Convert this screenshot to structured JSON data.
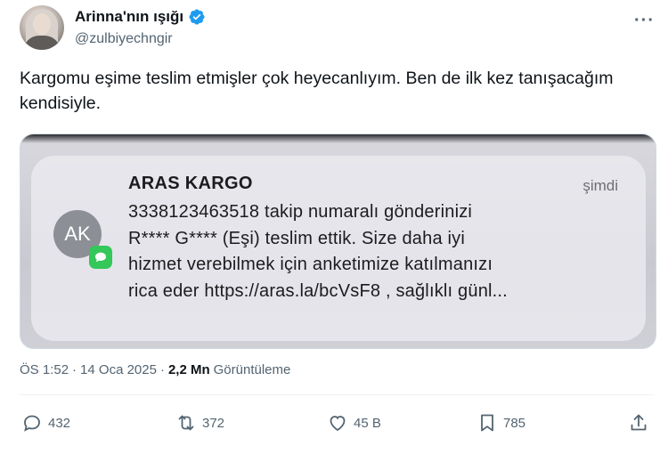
{
  "tweet": {
    "author": {
      "name": "Arinna'nın ışığı",
      "handle": "@zulbiyechngir",
      "verified_color": "#1d9bf0"
    },
    "text": "Kargomu eşime teslim etmişler çok heyecanlıyım. Ben de ilk kez tanışacağım kendisiyle.",
    "media": {
      "notification": {
        "avatar_initials": "AK",
        "badge_icon": "messages-icon",
        "sender": "ARAS KARGO",
        "time": "şimdi",
        "body": "3338123463518 takip numaralı gönderinizi\nR**** G**** (Eşi) teslim ettik. Size daha iyi\nhizmet verebilmek için anketimize katılmanızı\nrica eder https://aras.la/bcVsF8 , sağlıklı günl..."
      }
    },
    "meta": {
      "time": "ÖS 1:52",
      "separator": "·",
      "date": "14 Oca 2025",
      "separator2": "·",
      "views": "2,2 Mn",
      "views_label": "Görüntüleme"
    },
    "actions": {
      "replies": "432",
      "reposts": "372",
      "likes": "45 B",
      "bookmarks": "785"
    }
  }
}
